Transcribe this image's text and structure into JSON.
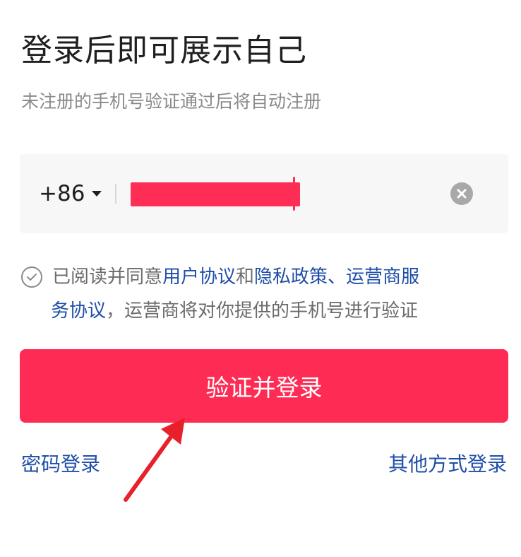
{
  "header": {
    "title": "登录后即可展示自己",
    "subtitle": "未注册的手机号验证通过后将自动注册"
  },
  "phone": {
    "country_code": "+86",
    "value": ""
  },
  "agreement": {
    "prefix": "已阅读并同意 ",
    "user_agreement": "用户协议",
    "and": " 和 ",
    "privacy_policy": "隐私政策、",
    "carrier_service_part1": "运营商服",
    "carrier_service_part2": "务协议",
    "suffix": "，运营商将对你提供的手机号进行验证"
  },
  "buttons": {
    "verify_login": "验证并登录",
    "password_login": "密码登录",
    "other_login": "其他方式登录"
  },
  "colors": {
    "accent": "#fe2c55",
    "link": "#1f4ea8"
  }
}
